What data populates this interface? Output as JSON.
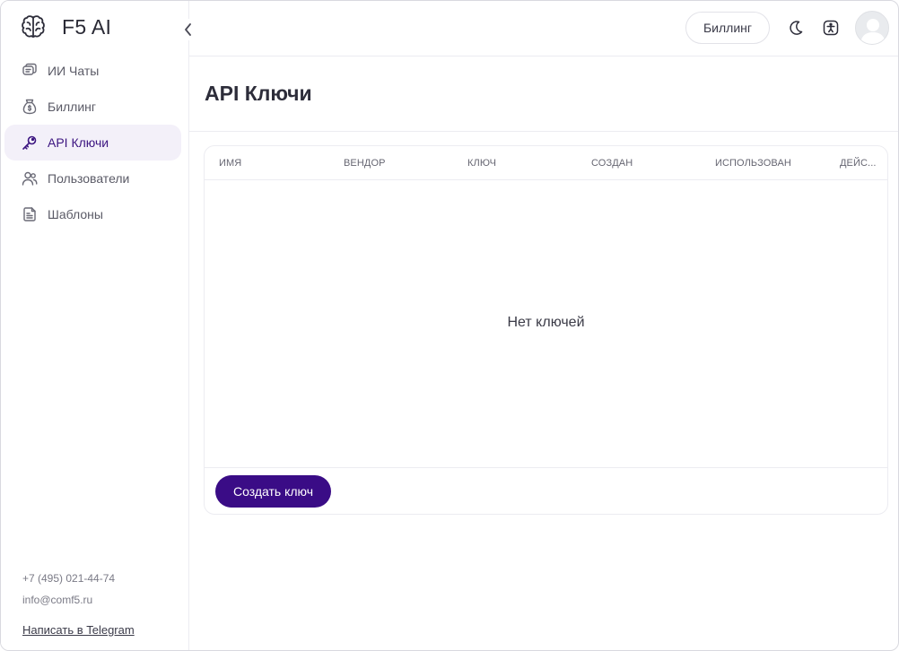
{
  "app": {
    "name": "F5 AI"
  },
  "sidebar": {
    "items": [
      {
        "label": "ИИ Чаты",
        "icon": "chat-icon",
        "active": false
      },
      {
        "label": "Биллинг",
        "icon": "money-bag-icon",
        "active": false
      },
      {
        "label": "API Ключи",
        "icon": "key-icon",
        "active": true
      },
      {
        "label": "Пользователи",
        "icon": "users-icon",
        "active": false
      },
      {
        "label": "Шаблоны",
        "icon": "template-icon",
        "active": false
      }
    ],
    "footer": {
      "phone": "+7 (495) 021-44-74",
      "email": "info@comf5.ru",
      "telegram_link": "Написать в Telegram"
    }
  },
  "header": {
    "billing_label": "Биллинг",
    "icons": [
      "moon-icon",
      "accessibility-icon",
      "avatar"
    ]
  },
  "page": {
    "title": "API Ключи"
  },
  "table": {
    "columns": [
      "ИМЯ",
      "ВЕНДОР",
      "КЛЮЧ",
      "СОЗДАН",
      "ИСПОЛЬЗОВАН",
      "ДЕЙС..."
    ],
    "rows": [],
    "empty_text": "Нет ключей",
    "create_label": "Создать ключ"
  },
  "colors": {
    "accent": "#3a0c86",
    "active_bg": "#f3f0f9",
    "active_text": "#3b1480",
    "border": "#ececf1"
  }
}
